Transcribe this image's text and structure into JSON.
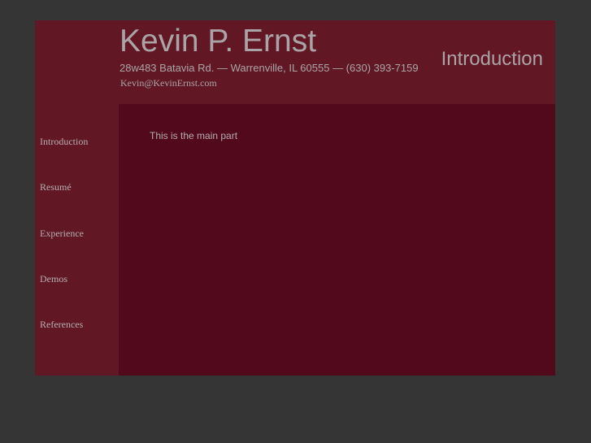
{
  "header": {
    "name": "Kevin P. Ernst",
    "address": "28w483 Batavia Rd. — Warrenville, IL 60555 — (630) 393-7159",
    "email": "Kevin@KevinErnst.com",
    "section_title": "Introduction"
  },
  "sidebar": {
    "items": [
      {
        "label": "Introduction"
      },
      {
        "label": "Resumé"
      },
      {
        "label": "Experience"
      },
      {
        "label": "Demos"
      },
      {
        "label": "References"
      }
    ]
  },
  "main": {
    "text": "This is the main part"
  },
  "colors": {
    "background": "#353535",
    "panel": "#611824",
    "content": "#52091b",
    "text": "#aaa4a6"
  }
}
